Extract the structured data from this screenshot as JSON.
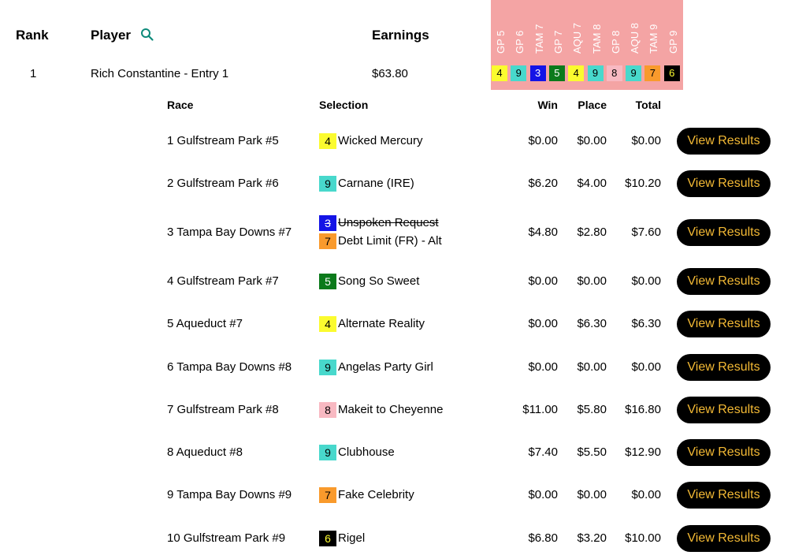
{
  "header": {
    "rank": "Rank",
    "player": "Player",
    "earnings": "Earnings"
  },
  "race_columns": [
    "GP 5",
    "GP 6",
    "TAM 7",
    "GP 7",
    "AQU 7",
    "TAM 8",
    "GP 8",
    "AQU 8",
    "TAM 9",
    "GP 9"
  ],
  "entry": {
    "rank": "1",
    "player": "Rich Constantine - Entry 1",
    "earnings": "$63.80",
    "picks": [
      {
        "num": "4",
        "bg": "#fbfb2f",
        "fg": "#000000"
      },
      {
        "num": "9",
        "bg": "#48d8cc",
        "fg": "#000000"
      },
      {
        "num": "3",
        "bg": "#1414e6",
        "fg": "#ffffff"
      },
      {
        "num": "5",
        "bg": "#0b7a1b",
        "fg": "#ffffff"
      },
      {
        "num": "4",
        "bg": "#fbfb2f",
        "fg": "#000000"
      },
      {
        "num": "9",
        "bg": "#48d8cc",
        "fg": "#000000"
      },
      {
        "num": "8",
        "bg": "#f8b9c2",
        "fg": "#000000"
      },
      {
        "num": "9",
        "bg": "#48d8cc",
        "fg": "#000000"
      },
      {
        "num": "7",
        "bg": "#f99a2c",
        "fg": "#000000"
      },
      {
        "num": "6",
        "bg": "#000000",
        "fg": "#fbfb2f"
      }
    ]
  },
  "detail_header": {
    "race": "Race",
    "selection": "Selection",
    "win": "Win",
    "place": "Place",
    "total": "Total"
  },
  "rows": [
    {
      "race": "1 Gulfstream Park #5",
      "chips": [
        {
          "num": "4",
          "bg": "#fbfb2f",
          "fg": "#000000",
          "name": "Wicked Mercury",
          "scratched": false
        }
      ],
      "win": "$0.00",
      "place": "$0.00",
      "total": "$0.00",
      "button": "View Results"
    },
    {
      "race": "2 Gulfstream Park #6",
      "chips": [
        {
          "num": "9",
          "bg": "#48d8cc",
          "fg": "#000000",
          "name": "Carnane (IRE)",
          "scratched": false
        }
      ],
      "win": "$6.20",
      "place": "$4.00",
      "total": "$10.20",
      "button": "View Results"
    },
    {
      "race": "3 Tampa Bay Downs #7",
      "chips": [
        {
          "num": "3",
          "bg": "#1414e6",
          "fg": "#ffffff",
          "name": "Unspoken Request",
          "scratched": true
        },
        {
          "num": "7",
          "bg": "#f99a2c",
          "fg": "#000000",
          "name": "Debt Limit (FR) - Alt",
          "scratched": false
        }
      ],
      "win": "$4.80",
      "place": "$2.80",
      "total": "$7.60",
      "button": "View Results"
    },
    {
      "race": "4 Gulfstream Park #7",
      "chips": [
        {
          "num": "5",
          "bg": "#0b7a1b",
          "fg": "#ffffff",
          "name": "Song So Sweet",
          "scratched": false
        }
      ],
      "win": "$0.00",
      "place": "$0.00",
      "total": "$0.00",
      "button": "View Results"
    },
    {
      "race": "5 Aqueduct #7",
      "chips": [
        {
          "num": "4",
          "bg": "#fbfb2f",
          "fg": "#000000",
          "name": "Alternate Reality",
          "scratched": false
        }
      ],
      "win": "$0.00",
      "place": "$6.30",
      "total": "$6.30",
      "button": "View Results"
    },
    {
      "race": "6 Tampa Bay Downs #8",
      "chips": [
        {
          "num": "9",
          "bg": "#48d8cc",
          "fg": "#000000",
          "name": "Angelas Party Girl",
          "scratched": false
        }
      ],
      "win": "$0.00",
      "place": "$0.00",
      "total": "$0.00",
      "button": "View Results"
    },
    {
      "race": "7 Gulfstream Park #8",
      "chips": [
        {
          "num": "8",
          "bg": "#f8b9c2",
          "fg": "#000000",
          "name": "Makeit to Cheyenne",
          "scratched": false
        }
      ],
      "win": "$11.00",
      "place": "$5.80",
      "total": "$16.80",
      "button": "View Results"
    },
    {
      "race": "8 Aqueduct #8",
      "chips": [
        {
          "num": "9",
          "bg": "#48d8cc",
          "fg": "#000000",
          "name": "Clubhouse",
          "scratched": false
        }
      ],
      "win": "$7.40",
      "place": "$5.50",
      "total": "$12.90",
      "button": "View Results"
    },
    {
      "race": "9 Tampa Bay Downs #9",
      "chips": [
        {
          "num": "7",
          "bg": "#f99a2c",
          "fg": "#000000",
          "name": "Fake Celebrity",
          "scratched": false
        }
      ],
      "win": "$0.00",
      "place": "$0.00",
      "total": "$0.00",
      "button": "View Results"
    },
    {
      "race": "10 Gulfstream Park #9",
      "chips": [
        {
          "num": "6",
          "bg": "#000000",
          "fg": "#fbfb2f",
          "name": "Rigel",
          "scratched": false
        }
      ],
      "win": "$6.80",
      "place": "$3.20",
      "total": "$10.00",
      "button": "View Results"
    }
  ],
  "colors": {
    "race_band": "#f4a4a4",
    "button_bg": "#000000",
    "button_text": "#f3b934",
    "search_icon": "#0d8a7a"
  },
  "icons": {
    "search": "search-icon"
  }
}
